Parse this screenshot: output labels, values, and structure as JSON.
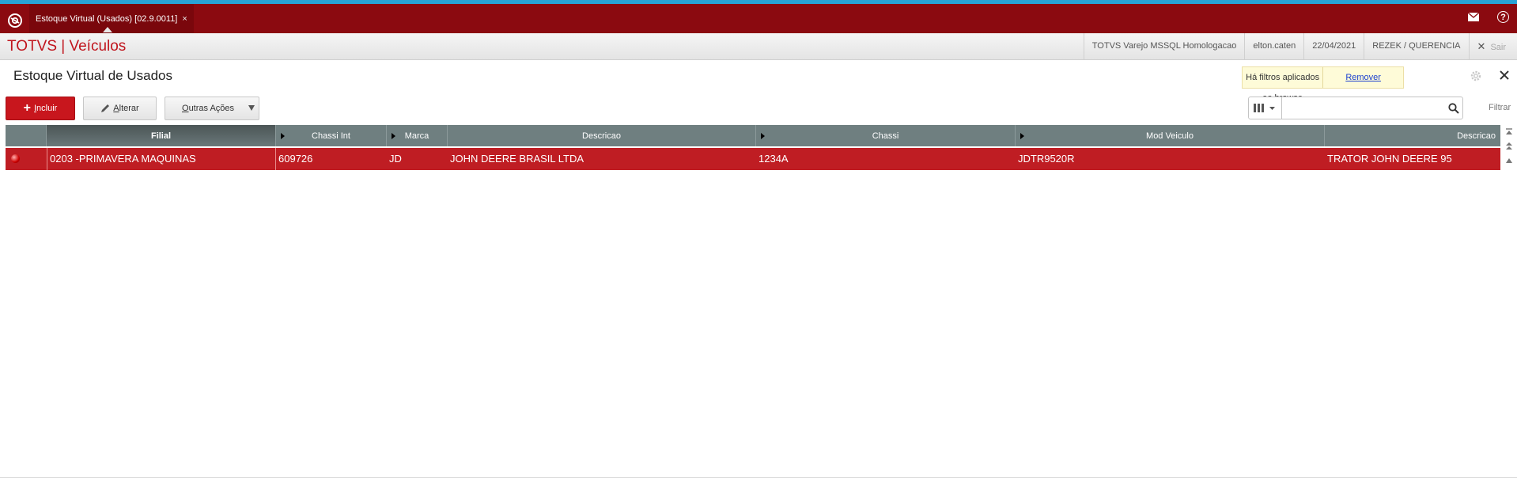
{
  "tab": {
    "label": "Estoque Virtual (Usados) [02.9.0011]",
    "close": "×"
  },
  "header": {
    "brand": "TOTVS | Veículos",
    "env": "TOTVS Varejo MSSQL Homologacao",
    "user": "elton.caten",
    "date": "22/04/2021",
    "company": "REZEK / QUERENCIA",
    "logout": "Sair"
  },
  "page": {
    "title": "Estoque Virtual de Usados"
  },
  "filter_notice": {
    "message": "Há filtros aplicados ao browse",
    "link": "Remover"
  },
  "toolbar": {
    "incluir_first": "I",
    "incluir_rest": "ncluir",
    "alterar_first": "A",
    "alterar_rest": "lterar",
    "outras_first": "O",
    "outras_rest": "utras Ações",
    "filtrar": "Filtrar"
  },
  "search": {
    "value": "",
    "placeholder": ""
  },
  "grid": {
    "columns": [
      {
        "label": "Filial",
        "sorted": true,
        "triangle": false
      },
      {
        "label": "Chassi Int",
        "sorted": false,
        "triangle": true
      },
      {
        "label": "Marca",
        "sorted": false,
        "triangle": true
      },
      {
        "label": "Descricao",
        "sorted": false,
        "triangle": false
      },
      {
        "label": "Chassi",
        "sorted": false,
        "triangle": true
      },
      {
        "label": "Mod Veiculo",
        "sorted": false,
        "triangle": true
      },
      {
        "label": "Descricao",
        "sorted": false,
        "triangle": false
      }
    ],
    "rows": [
      {
        "filial": "0203  -PRIMAVERA MAQUINAS",
        "chassi_int": "609726",
        "marca": "JD",
        "descricao": "JOHN DEERE BRASIL LTDA",
        "chassi": "1234A",
        "mod_veiculo": "JDTR9520R",
        "descricao2": "TRATOR JOHN DEERE 95"
      }
    ]
  },
  "colors": {
    "topbar": "#8b0a10",
    "brand": "#c0151d",
    "selected_row": "#bf1d23",
    "grid_header": "#6f7f80",
    "notice_bg": "#fefbd8",
    "accent_strip": "#29a3d6"
  },
  "icons": {
    "app_logo": "app-logo-icon",
    "mail": "mail-icon",
    "help": "help-icon",
    "gear": "gear-icon",
    "close": "close-icon",
    "search": "search-icon",
    "columns": "columns-icon",
    "pencil": "pencil-icon",
    "plus": "plus-icon",
    "legend": "status-legend-icon"
  }
}
